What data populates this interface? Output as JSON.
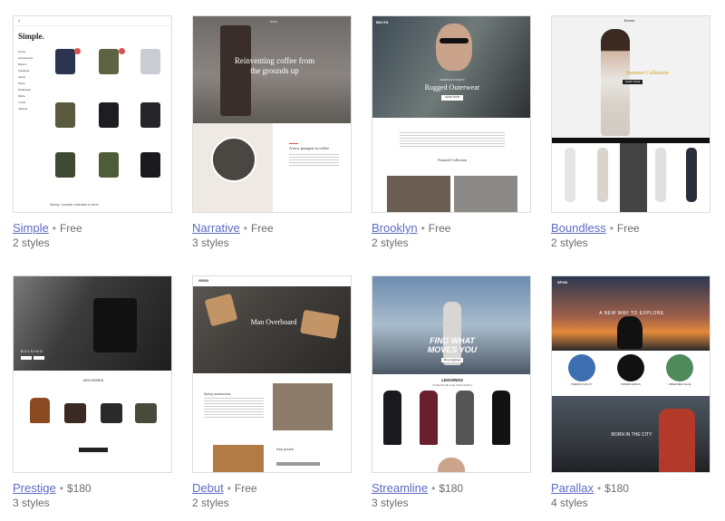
{
  "themes": [
    {
      "name": "Simple",
      "price": "Free",
      "styles": "2 styles",
      "preview": {
        "logo": "Simple.",
        "menu": [
          "Home",
          "Accessories",
          "Bottom",
          "Footwear",
          "Jeans",
          "Pants",
          "Outerwear",
          "Shirts",
          "T-shirt",
          "Jackets"
        ],
        "footer": "Spring / summer collection is here!"
      }
    },
    {
      "name": "Narrative",
      "price": "Free",
      "styles": "3 styles",
      "preview": {
        "brand": "NAVA",
        "headline": "Reinventing coffee from the grounds up",
        "sub": "A new paragon in coffee"
      }
    },
    {
      "name": "Brooklyn",
      "price": "Free",
      "styles": "2 styles",
      "preview": {
        "brand": "BKLYN",
        "eyebrow": "AMERICA'S FINEST",
        "headline": "Rugged Outerwear",
        "cta": "SHOP NOW",
        "section": "Featured Collection"
      }
    },
    {
      "name": "Boundless",
      "price": "Free",
      "styles": "2 styles",
      "preview": {
        "brand": "Boreas",
        "headline": "Summer Collection",
        "cta": "SHOP NOW"
      }
    },
    {
      "name": "Prestige",
      "price": "$180",
      "styles": "3 styles",
      "preview": {
        "headline": "BOLDING",
        "section": "MEN WOMEN"
      }
    },
    {
      "name": "Debut",
      "price": "Free",
      "styles": "2 styles",
      "preview": {
        "brand": "VIRGO",
        "headline": "Man Overboard",
        "section": "Spring accessories",
        "product": "Key pouch"
      }
    },
    {
      "name": "Streamline",
      "price": "$180",
      "styles": "3 styles",
      "preview": {
        "headline1": "FIND WHAT",
        "headline2": "MOVES YOU",
        "cta": "Shop leggings",
        "section": "LEGGINGS",
        "sub": "Sculpted fit with 4-way stretch stitching"
      }
    },
    {
      "name": "Parallax",
      "price": "$180",
      "styles": "4 styles",
      "preview": {
        "brand": "SPUN",
        "headline": "A NEW WAY TO EXPLORE",
        "features": [
          "PREMIUM QUALITY",
          "MODERN DESIGN",
          "UNBEATABLE VALUE"
        ],
        "banner": "BORN IN THE CITY"
      }
    }
  ],
  "colors": {
    "link": "#5c6ac4",
    "meta": "#6b6b6b",
    "border": "#dcdcdc"
  }
}
